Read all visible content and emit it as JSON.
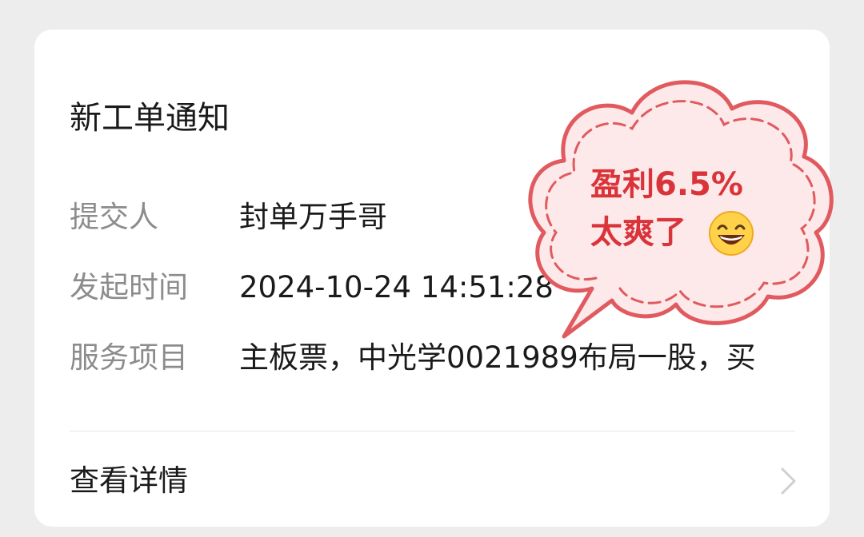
{
  "card": {
    "title": "新工单通知",
    "more_icon": "more-horizontal-icon",
    "fields": [
      {
        "label": "提交人",
        "value": "封单万手哥"
      },
      {
        "label": "发起时间",
        "value": "2024-10-24 14:51:28"
      },
      {
        "label": "服务项目",
        "value": "主板票，中光学0021989布局一股，买"
      }
    ],
    "details_label": "查看详情",
    "chevron_icon": "chevron-right-icon"
  },
  "sticker": {
    "line1": "盈利6.5%",
    "line2": "太爽了",
    "emoji_icon": "grinning-face-emoji",
    "colors": {
      "fill": "#fde9ea",
      "outline": "#e05a5f",
      "text": "#d9343a"
    }
  }
}
